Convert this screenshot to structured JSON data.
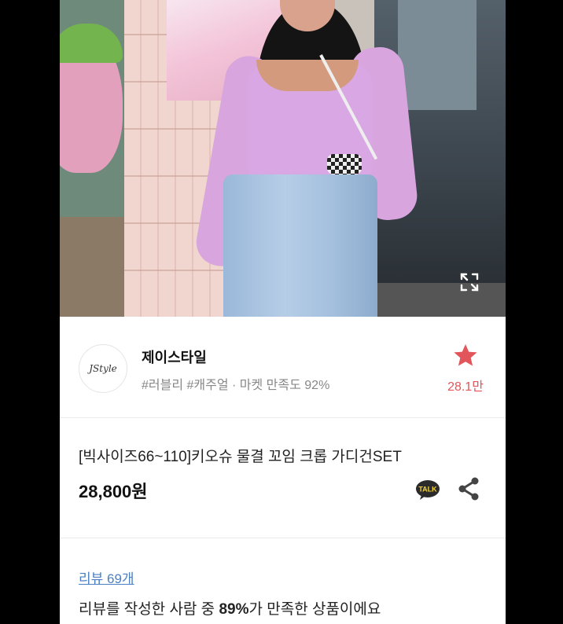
{
  "shop": {
    "logo_text": "JStyle",
    "name": "제이스타일",
    "tags": "#러블리 #캐주얼 · 마켓 만족도 92%",
    "favorite_count": "28.1만"
  },
  "product": {
    "name": "[빅사이즈66~110]키오슈 물결 꼬임 크롭 가디건SET",
    "price": "28,800원",
    "talk_label": "TALK"
  },
  "review": {
    "link_label": "리뷰 69개",
    "summary_prefix": "리뷰를 작성한 사람 중 ",
    "summary_percent": "89%",
    "summary_suffix": "가 만족한 상품이에요"
  },
  "colors": {
    "accent": "#e2555a",
    "link": "#4a7fc1"
  },
  "icons": [
    "expand-icon",
    "star-icon",
    "kakao-talk-icon",
    "share-icon"
  ]
}
